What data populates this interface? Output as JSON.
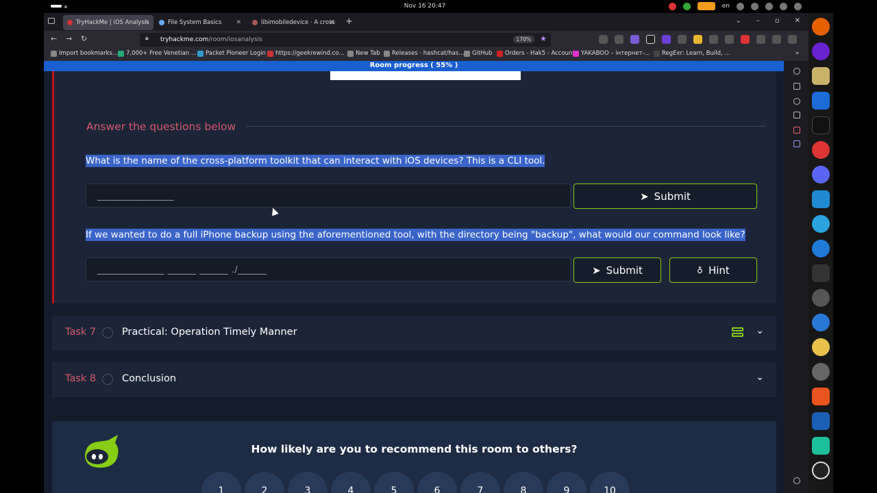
{
  "system": {
    "clock": "Nov 16  20:47",
    "lang": "en"
  },
  "tabs": [
    {
      "label": "TryHackMe | iOS Analysis",
      "active": true
    },
    {
      "label": "File System Basics",
      "active": false
    },
    {
      "label": "libimobiledevice · A cross",
      "active": false
    }
  ],
  "urlbar": {
    "host": "tryhackme.com",
    "path": "/room/iosanalysis",
    "zoom": "170%"
  },
  "bookmarks": [
    "Import bookmarks...",
    "7,000+ Free Venetian ...",
    "Packet Pioneer Login",
    "https://geekrewind.co...",
    "New Tab",
    "Releases · hashcat/has...",
    "GitHub",
    "Orders - Hak5 - Account",
    "YAKABOO – інтернет-...",
    "RegExr: Learn, Build, ..."
  ],
  "room_progress": "Room progress ( 55% )",
  "answer_section": {
    "heading": "Answer the questions below",
    "q1": {
      "question": "What is the name of the cross-platform toolkit that can interact with iOS devices? This is a CLI tool.",
      "placeholder": "________________",
      "submit": "Submit"
    },
    "q2": {
      "question": "If we wanted to do a full iPhone backup using the aforementioned tool, with the directory being \"backup\", what would our command look like?",
      "placeholder": "______________ ______ ______ ./______",
      "submit": "Submit",
      "hint": "Hint"
    }
  },
  "tasks": [
    {
      "number": "Task 7",
      "title": "Practical: Operation Timely Manner"
    },
    {
      "number": "Task 8",
      "title": "Conclusion"
    }
  ],
  "survey": {
    "question": "How likely are you to recommend this room to others?",
    "scale": [
      "1",
      "2",
      "3",
      "4",
      "5",
      "6",
      "7",
      "8",
      "9",
      "10"
    ]
  },
  "colors": {
    "accent_green": "#88cc14",
    "task_red": "#d8576c",
    "progress_blue": "#1a5fd0"
  }
}
